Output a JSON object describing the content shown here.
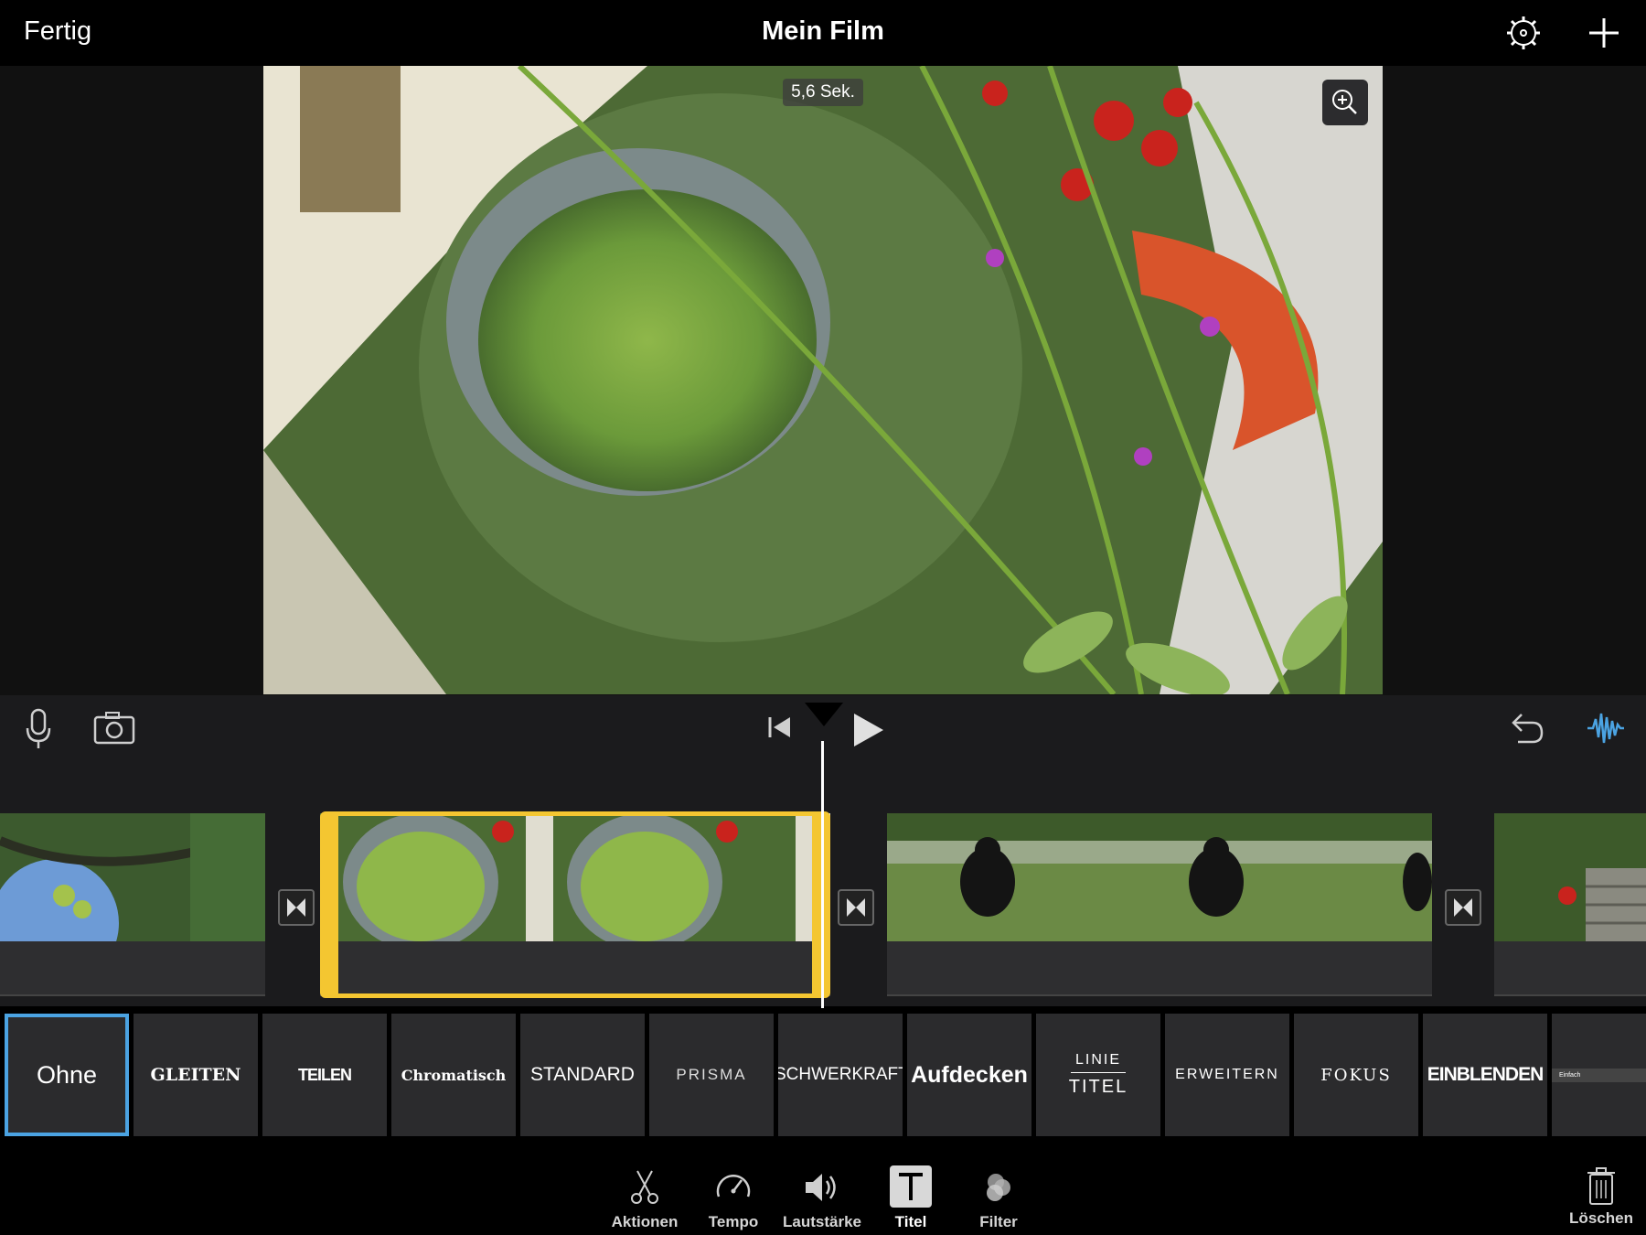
{
  "header": {
    "done_label": "Fertig",
    "title": "Mein Film"
  },
  "viewer": {
    "duration_badge": "5,6 Sek."
  },
  "title_styles": [
    {
      "label": "Ohne",
      "selected": true
    },
    {
      "label": "GLEITEN"
    },
    {
      "label": "TEILEN"
    },
    {
      "label": "Chromatisch"
    },
    {
      "label": "STANDARD"
    },
    {
      "label": "PRISMA"
    },
    {
      "label": "SCHWERKRAFT"
    },
    {
      "label": "Aufdecken"
    },
    {
      "label_top": "LINIE",
      "label_bottom": "TITEL"
    },
    {
      "label": "ERWEITERN"
    },
    {
      "label": "FOKUS"
    },
    {
      "label": "EINBLENDEN"
    },
    {
      "label": "Einfach"
    }
  ],
  "toolbar": {
    "actions": "Aktionen",
    "speed": "Tempo",
    "volume": "Lautstärke",
    "titles": "Titel",
    "filters": "Filter",
    "delete": "Löschen"
  },
  "colors": {
    "accent_selection": "#f4c631",
    "accent_blue": "#4ba3e2"
  }
}
